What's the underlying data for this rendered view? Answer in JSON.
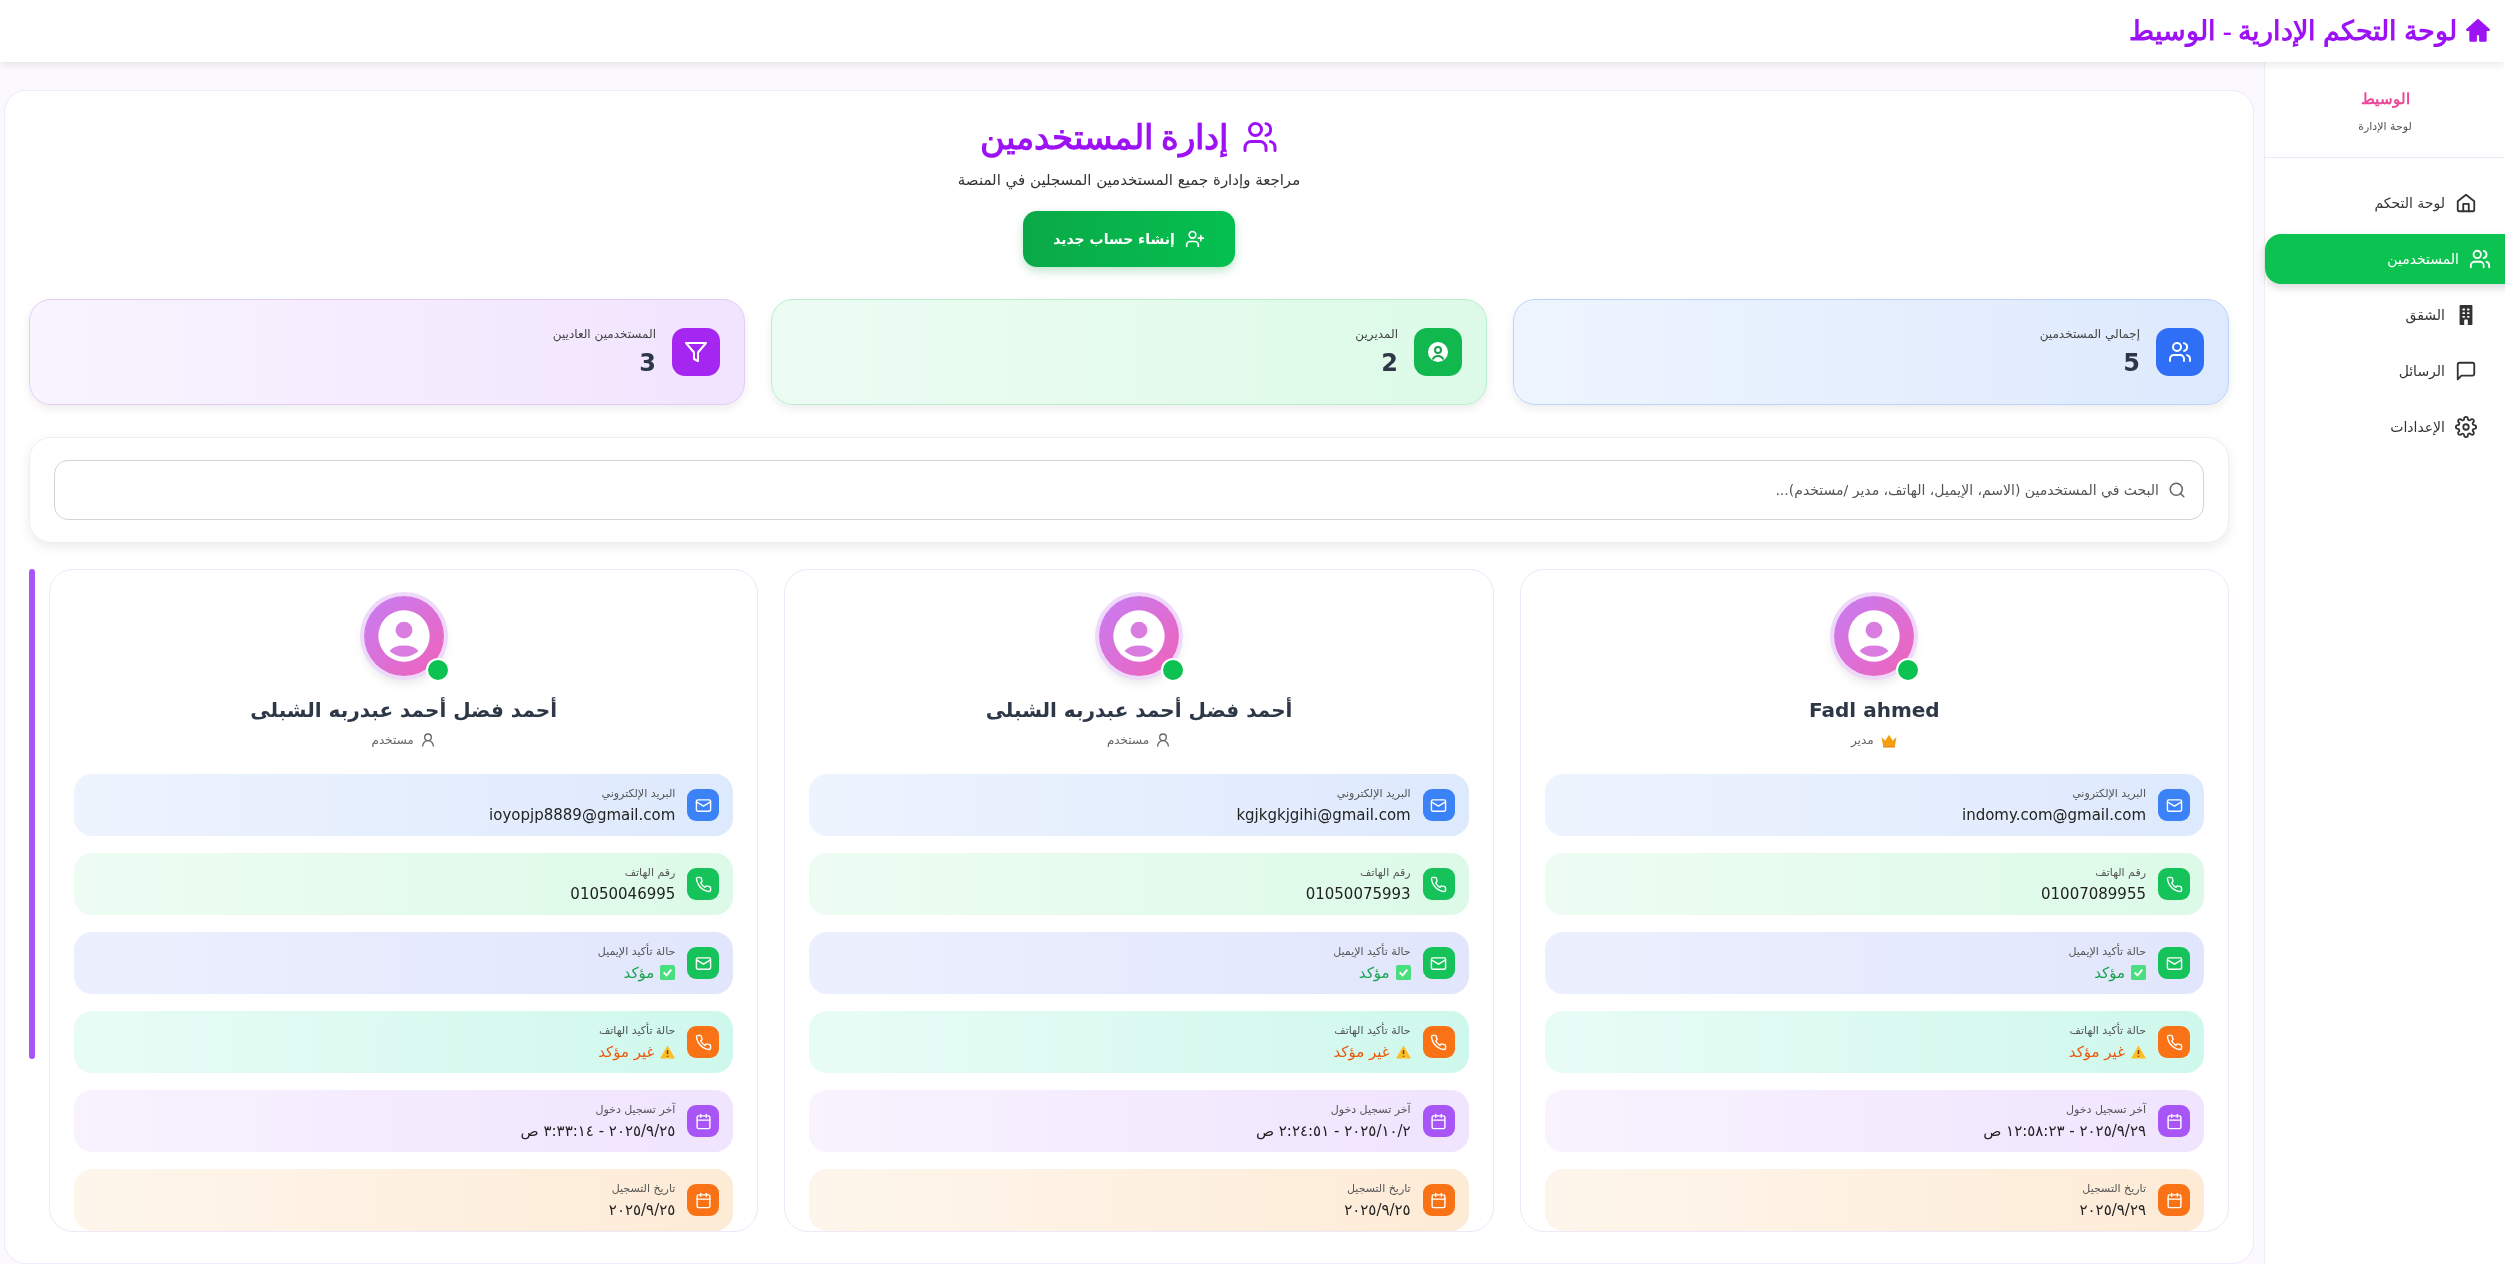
{
  "header": {
    "title": "لوحة التحكم الإدارية - الوسيط"
  },
  "sidebar": {
    "brand": "الوسيط",
    "subtitle": "لوحة الإدارة",
    "items": [
      {
        "label": "لوحة التحكم",
        "kind": "home",
        "selected": false
      },
      {
        "label": "المستخدمين",
        "kind": "users",
        "selected": true
      },
      {
        "label": "الشقق",
        "kind": "building",
        "selected": false
      },
      {
        "label": "الرسائل",
        "kind": "message",
        "selected": false
      },
      {
        "label": "الإعدادات",
        "kind": "settings",
        "selected": false
      }
    ]
  },
  "page": {
    "title": "إدارة المستخدمين",
    "subtitle": "مراجعة وإدارة جميع المستخدمين المسجلين في المنصة",
    "create_button": "إنشاء حساب جديد"
  },
  "stats": [
    {
      "label": "إجمالي المستخدمين",
      "value": "5",
      "kind": "total"
    },
    {
      "label": "المديرين",
      "value": "2",
      "kind": "admins"
    },
    {
      "label": "المستخدمين العاديين",
      "value": "3",
      "kind": "regular"
    }
  ],
  "search": {
    "placeholder": "البحث في المستخدمين (الاسم، الإيميل، الهاتف، مدير /مستخدم)..."
  },
  "users": [
    {
      "name": "Fadl ahmed",
      "online": true,
      "role": {
        "label": "مدير",
        "kind": "admin"
      },
      "fields": [
        {
          "kind": "email",
          "label": "البريد الإلكتروني",
          "value": "indomy.com@gmail.com"
        },
        {
          "kind": "phone",
          "label": "رقم الهاتف",
          "value": "01007089955"
        },
        {
          "kind": "email_status",
          "label": "حالة تأكيد الإيميل",
          "value": "مؤكد",
          "verified": true
        },
        {
          "kind": "phone_status",
          "label": "حالة تأكيد الهاتف",
          "value": "غير مؤكد",
          "verified": false
        },
        {
          "kind": "last_login",
          "label": "آخر تسجيل دخول",
          "value": "٢٠٢٥/٩/٢٩ - ١٢:٥٨:٢٣ ص"
        },
        {
          "kind": "registered",
          "label": "تاريخ التسجيل",
          "value": "٢٠٢٥/٩/٢٩"
        }
      ]
    },
    {
      "name": "أحمد فضل أحمد عبدربه الشبلى",
      "online": true,
      "role": {
        "label": "مستخدم",
        "kind": "user"
      },
      "fields": [
        {
          "kind": "email",
          "label": "البريد الإلكتروني",
          "value": "kgjkgkjgihi@gmail.com"
        },
        {
          "kind": "phone",
          "label": "رقم الهاتف",
          "value": "01050075993"
        },
        {
          "kind": "email_status",
          "label": "حالة تأكيد الإيميل",
          "value": "مؤكد",
          "verified": true
        },
        {
          "kind": "phone_status",
          "label": "حالة تأكيد الهاتف",
          "value": "غير مؤكد",
          "verified": false
        },
        {
          "kind": "last_login",
          "label": "آخر تسجيل دخول",
          "value": "٢٠٢٥/١٠/٢ - ٢:٢٤:٥١ ص"
        },
        {
          "kind": "registered",
          "label": "تاريخ التسجيل",
          "value": "٢٠٢٥/٩/٢٥"
        }
      ]
    },
    {
      "name": "أحمد فضل أحمد عبدربه الشبلى",
      "online": true,
      "role": {
        "label": "مستخدم",
        "kind": "user"
      },
      "fields": [
        {
          "kind": "email",
          "label": "البريد الإلكتروني",
          "value": "ioyopjp8889@gmail.com"
        },
        {
          "kind": "phone",
          "label": "رقم الهاتف",
          "value": "01050046995"
        },
        {
          "kind": "email_status",
          "label": "حالة تأكيد الإيميل",
          "value": "مؤكد",
          "verified": true
        },
        {
          "kind": "phone_status",
          "label": "حالة تأكيد الهاتف",
          "value": "غير مؤكد",
          "verified": false
        },
        {
          "kind": "last_login",
          "label": "آخر تسجيل دخول",
          "value": "٢٠٢٥/٩/٢٥ - ٣:٣٣:١٤ ص"
        },
        {
          "kind": "registered",
          "label": "تاريخ التسجيل",
          "value": "٢٠٢٥/٩/٢٥"
        }
      ]
    }
  ]
}
